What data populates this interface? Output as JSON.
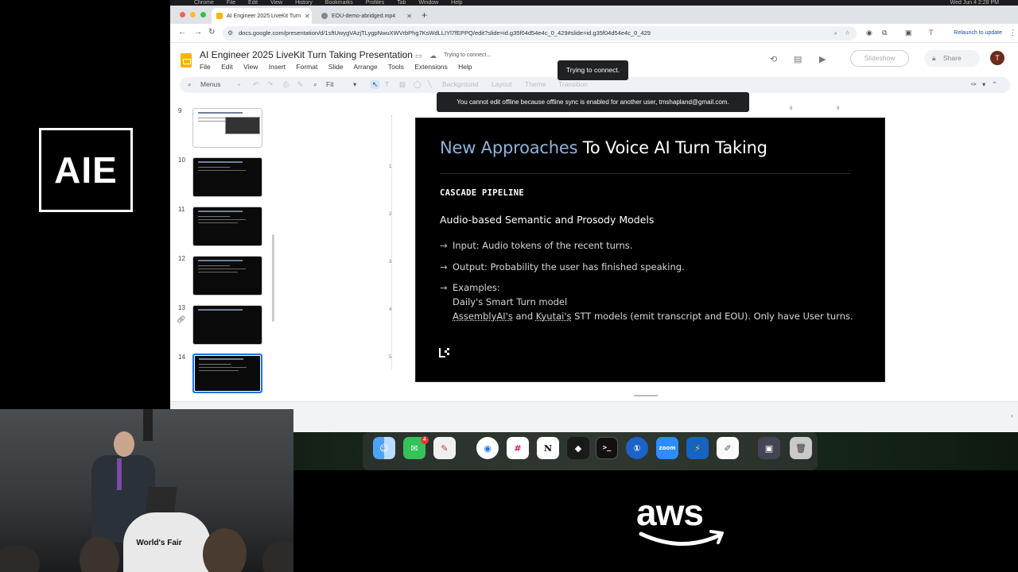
{
  "event": {
    "logo_text": "AIE",
    "sponsor": "aws",
    "podium_text": "World's Fair"
  },
  "menubar": {
    "items": [
      "Chrome",
      "File",
      "Edit",
      "View",
      "History",
      "Bookmarks",
      "Profiles",
      "Tab",
      "Window",
      "Help"
    ],
    "clock": "Wed Jun 4  2:28 PM"
  },
  "browser": {
    "tabs": [
      {
        "label": "AI Engineer 2025 LiveKit Turn",
        "active": true
      },
      {
        "label": "EOU-demo-abridged.mp4",
        "active": false
      }
    ],
    "url": "docs.google.com/presentation/d/1sftUwygVAzjTLygpNwuXWVrbPhg7KsWdLLIYl7fEPPQ/edit?slide=id.g35f04d54e4c_0_429#slide=id.g35f04d54e4c_0_429",
    "relaunch_label": "Relaunch to update"
  },
  "docs": {
    "title": "AI Engineer 2025 LiveKit Turn Taking Presentation",
    "status": "Trying to connect...",
    "menu": [
      "File",
      "Edit",
      "View",
      "Insert",
      "Format",
      "Slide",
      "Arrange",
      "Tools",
      "Extensions",
      "Help"
    ],
    "slideshow_label": "Slideshow",
    "share_label": "Share",
    "avatar_initial": "T"
  },
  "toolbar": {
    "menus_label": "Menus",
    "zoom": "Fit",
    "background_label": "Background",
    "layout_label": "Layout",
    "theme_label": "Theme",
    "transition_label": "Transition"
  },
  "toasts": {
    "connecting": "Trying to connect.",
    "offline": "You cannot edit offline because offline sync is enabled for another user, tmshapland@gmail.com."
  },
  "filmstrip": {
    "slides": [
      {
        "number": "9",
        "style": "light"
      },
      {
        "number": "10",
        "style": "diagram"
      },
      {
        "number": "11",
        "style": "dark"
      },
      {
        "number": "12",
        "style": "dark"
      },
      {
        "number": "13",
        "style": "dark"
      },
      {
        "number": "14",
        "style": "dark",
        "selected": true
      }
    ]
  },
  "ruler": {
    "top": [
      "8",
      "9"
    ],
    "left": [
      "1",
      "2",
      "3",
      "4",
      "5"
    ]
  },
  "slide": {
    "title_accent": "New Approaches",
    "title_rest": " To Voice AI Turn Taking",
    "section": "CASCADE PIPELINE",
    "subtitle": "Audio-based Semantic and Prosody Models",
    "arrow": "→",
    "bullet1": "Input: Audio tokens of the recent turns.",
    "bullet2": "Output: Probability the user has finished speaking.",
    "bullet3": "Examples:",
    "example1": "Daily's Smart Turn model",
    "example2_a": "AssemblyAI's",
    "example2_b": " and ",
    "example2_c": "Kyutai's",
    "example2_d": " STT models (emit transcript and EOU). Only have User turns.",
    "footer_logo": "LK"
  },
  "dock": {
    "apps": [
      "finder",
      "messages",
      "notes",
      "chrome",
      "slack",
      "notion",
      "cursor",
      "terminal",
      "1password",
      "zoom",
      "bolt",
      "textedit",
      "preview",
      "trash"
    ],
    "messages_badge": "4",
    "zoom_label": "zoom",
    "notion_label": "N"
  },
  "colors": {
    "title_accent": "#8fb3d9",
    "slide_bg": "#000000",
    "toast_bg": "#202124",
    "share_blue": "#1a73e8",
    "slides_yellow": "#f6b400"
  }
}
